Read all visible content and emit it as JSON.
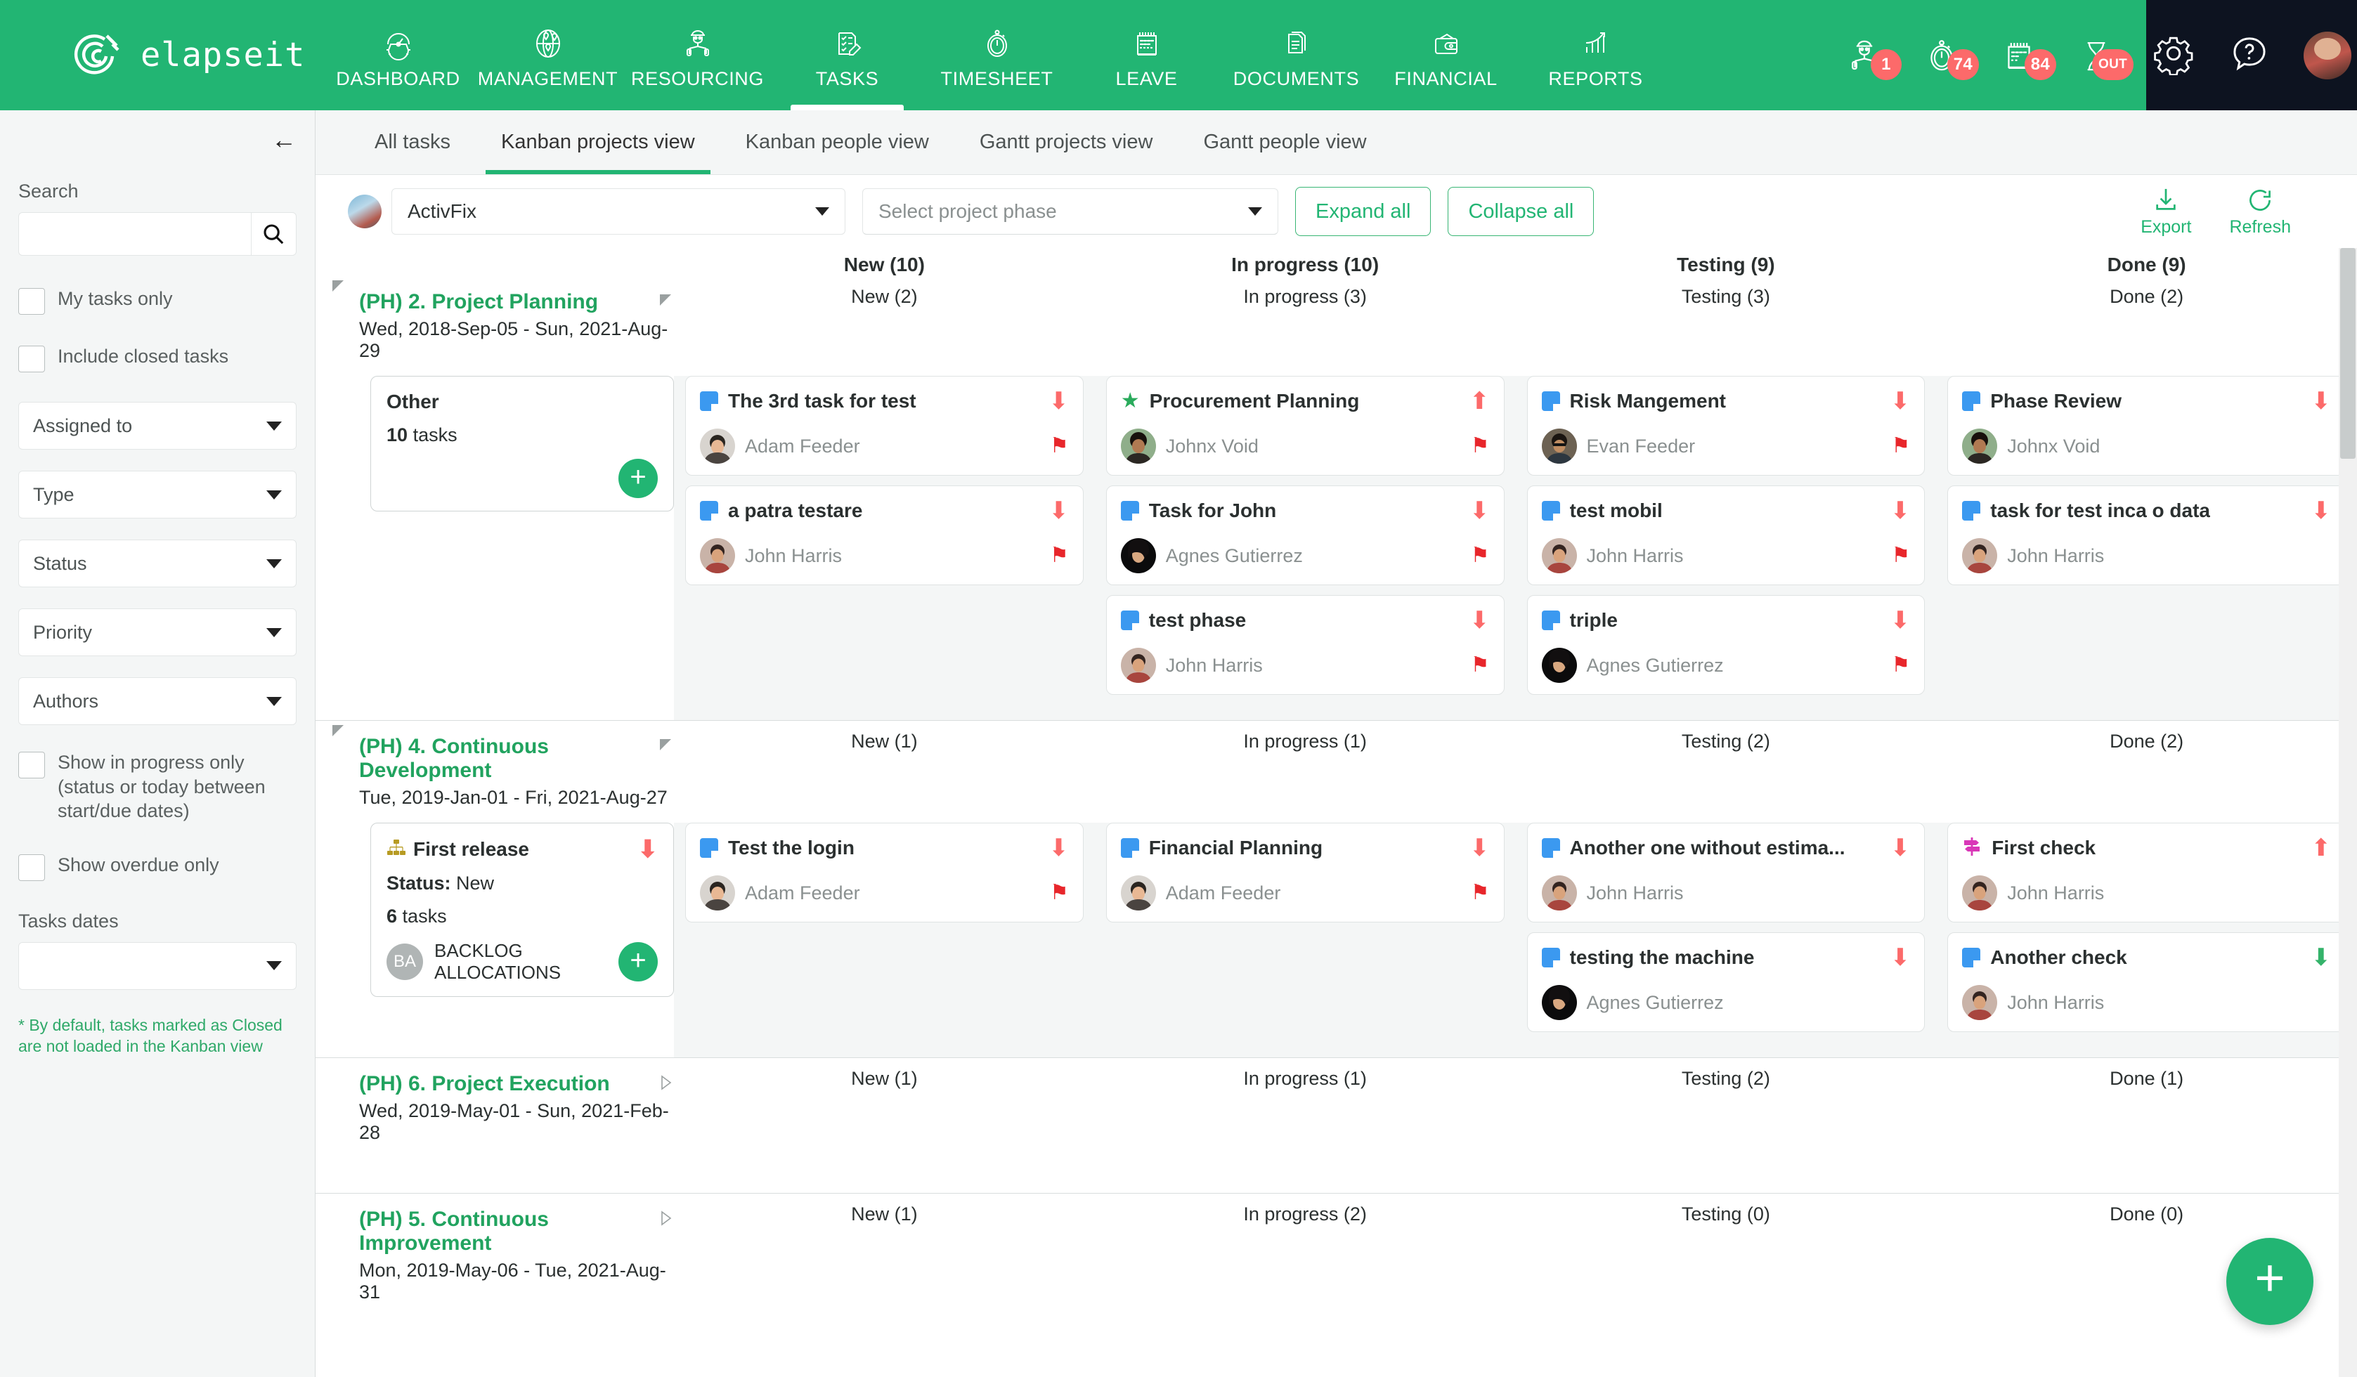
{
  "brand": {
    "name": "elapseit",
    "logo_icon": "elapseit-logo-icon"
  },
  "topnav": {
    "items": [
      {
        "label": "DASHBOARD",
        "icon": "gauge-gear-icon",
        "active": false
      },
      {
        "label": "MANAGEMENT",
        "icon": "globe-pin-icon",
        "active": false
      },
      {
        "label": "RESOURCING",
        "icon": "worker-blueprint-icon",
        "active": false
      },
      {
        "label": "TASKS",
        "icon": "checklist-pencil-icon",
        "active": true
      },
      {
        "label": "TIMESHEET",
        "icon": "stopwatch-icon",
        "active": false
      },
      {
        "label": "LEAVE",
        "icon": "calendar-icon",
        "active": false
      },
      {
        "label": "DOCUMENTS",
        "icon": "documents-icon",
        "active": false
      },
      {
        "label": "FINANCIAL",
        "icon": "wallet-icon",
        "active": false
      },
      {
        "label": "REPORTS",
        "icon": "growth-chart-icon",
        "active": false
      }
    ],
    "badges": [
      {
        "icon": "worker-blueprint-icon",
        "value": "1"
      },
      {
        "icon": "stopwatch-icon",
        "value": "74"
      },
      {
        "icon": "calendar-icon",
        "value": "84"
      },
      {
        "icon": "hourglass-icon",
        "value": "OUT"
      }
    ],
    "dark_actions": [
      {
        "icon": "gear-icon"
      },
      {
        "icon": "help-question-icon"
      },
      {
        "icon": "user-avatar"
      }
    ]
  },
  "sidebar": {
    "collapse_icon": "arrow-left-icon",
    "search_label": "Search",
    "search_value": "",
    "search_placeholder": "",
    "search_icon": "search-icon",
    "checkboxes": [
      {
        "label": "My tasks only",
        "checked": false
      },
      {
        "label": "Include closed tasks",
        "checked": false
      }
    ],
    "selects": [
      {
        "label": "Assigned to"
      },
      {
        "label": "Type"
      },
      {
        "label": "Status"
      },
      {
        "label": "Priority"
      },
      {
        "label": "Authors"
      }
    ],
    "checkboxes2": [
      {
        "label": "Show in progress only (status or today between start/due dates)",
        "checked": false
      },
      {
        "label": "Show overdue only",
        "checked": false
      }
    ],
    "dates_label": "Tasks dates",
    "dates_value": "",
    "note": "* By default, tasks marked as Closed are not loaded in the Kanban view"
  },
  "tabs": [
    {
      "label": "All tasks",
      "active": false
    },
    {
      "label": "Kanban projects view",
      "active": true
    },
    {
      "label": "Kanban people view",
      "active": false
    },
    {
      "label": "Gantt projects view",
      "active": false
    },
    {
      "label": "Gantt people view",
      "active": false
    }
  ],
  "toolbar": {
    "project_value": "ActivFix",
    "phase_placeholder": "Select project phase",
    "expand_label": "Expand all",
    "collapse_label": "Collapse all",
    "export_label": "Export",
    "export_icon": "download-icon",
    "refresh_label": "Refresh",
    "refresh_icon": "refresh-icon"
  },
  "board": {
    "columns": [
      "New (10)",
      "In progress (10)",
      "Testing (9)",
      "Done (9)"
    ],
    "phases": [
      {
        "title": "(PH) 2. Project Planning",
        "dates": "Wed, 2018-Sep-05 - Sun, 2021-Aug-29",
        "expanded": true,
        "sub_heads": [
          "New (2)",
          "In progress (3)",
          "Testing (3)",
          "Done (2)"
        ],
        "group_card": {
          "title": "Other",
          "icon": "",
          "count_line": "10 tasks",
          "count_num": "10",
          "count_word": "tasks",
          "status_line": "",
          "badge": "",
          "badge_label": "",
          "add_icon": "plus-icon"
        },
        "cards": [
          [
            {
              "title": "The 3rd task for test",
              "icon": "note-icon",
              "priority": "down",
              "assignee": "Adam Feeder",
              "flag": true
            },
            {
              "title": "a patra testare",
              "icon": "note-icon",
              "priority": "down",
              "assignee": "John Harris",
              "flag": true
            }
          ],
          [
            {
              "title": "Procurement Planning",
              "icon": "star-icon",
              "priority": "up",
              "assignee": "Johnx Void",
              "flag": true
            },
            {
              "title": "Task for John",
              "icon": "note-icon",
              "priority": "down",
              "assignee": "Agnes Gutierrez",
              "flag": true
            },
            {
              "title": "test phase",
              "icon": "note-icon",
              "priority": "down",
              "assignee": "John Harris",
              "flag": true
            }
          ],
          [
            {
              "title": "Risk Mangement",
              "icon": "note-icon",
              "priority": "down",
              "assignee": "Evan Feeder",
              "flag": true
            },
            {
              "title": "test mobil",
              "icon": "note-icon",
              "priority": "down",
              "assignee": "John Harris",
              "flag": true
            },
            {
              "title": "triple",
              "icon": "note-icon",
              "priority": "down",
              "assignee": "Agnes Gutierrez",
              "flag": true
            }
          ],
          [
            {
              "title": "Phase Review",
              "icon": "note-icon",
              "priority": "down",
              "assignee": "Johnx Void",
              "flag": false
            },
            {
              "title": "task for test inca o data",
              "icon": "note-icon",
              "priority": "down",
              "assignee": "John Harris",
              "flag": false
            }
          ]
        ]
      },
      {
        "title": "(PH) 4. Continuous Development",
        "dates": "Tue, 2019-Jan-01 - Fri, 2021-Aug-27",
        "expanded": true,
        "sub_heads": [
          "New (1)",
          "In progress (1)",
          "Testing (2)",
          "Done (2)"
        ],
        "group_card": {
          "title": "First release",
          "icon": "sitemap-icon",
          "status_line": "Status: New",
          "status_key": "Status:",
          "status_val": "New",
          "count_line": "6 tasks",
          "count_num": "6",
          "count_word": "tasks",
          "badge": "BA",
          "badge_label": "BACKLOG ALLOCATIONS",
          "priority": "down",
          "add_icon": "plus-icon"
        },
        "cards": [
          [
            {
              "title": "Test the login",
              "icon": "note-icon",
              "priority": "down",
              "assignee": "Adam Feeder",
              "flag": true
            }
          ],
          [
            {
              "title": "Financial Planning",
              "icon": "note-icon",
              "priority": "down",
              "assignee": "Adam Feeder",
              "flag": true
            }
          ],
          [
            {
              "title": "Another one without estima...",
              "icon": "note-icon",
              "priority": "down",
              "assignee": "John Harris",
              "flag": false
            },
            {
              "title": "testing the machine",
              "icon": "note-icon",
              "priority": "down",
              "assignee": "Agnes Gutierrez",
              "flag": false
            }
          ],
          [
            {
              "title": "First check",
              "icon": "signpost-icon",
              "priority": "up",
              "assignee": "John Harris",
              "flag": false
            },
            {
              "title": "Another check",
              "icon": "note-icon",
              "priority": "down-green",
              "assignee": "John Harris",
              "flag": false
            }
          ]
        ]
      },
      {
        "title": "(PH) 6. Project Execution",
        "dates": "Wed, 2019-May-01 - Sun, 2021-Feb-28",
        "expanded": false,
        "sub_heads": [
          "New (1)",
          "In progress (1)",
          "Testing (2)",
          "Done (1)"
        ],
        "group_card": null,
        "cards": [
          [],
          [],
          [],
          []
        ]
      },
      {
        "title": "(PH) 5. Continuous Improvement",
        "dates": "Mon, 2019-May-06 - Tue, 2021-Aug-31",
        "expanded": false,
        "sub_heads": [
          "New (1)",
          "In progress (2)",
          "Testing (0)",
          "Done (0)"
        ],
        "group_card": null,
        "cards": [
          [],
          [],
          [],
          []
        ]
      }
    ],
    "fab_icon": "plus-icon"
  },
  "colors": {
    "brand_green": "#22b573",
    "accent_green": "#21a35f",
    "danger": "#fc6a6a",
    "flag_red": "#e8262b",
    "note_blue": "#3b99f0"
  }
}
